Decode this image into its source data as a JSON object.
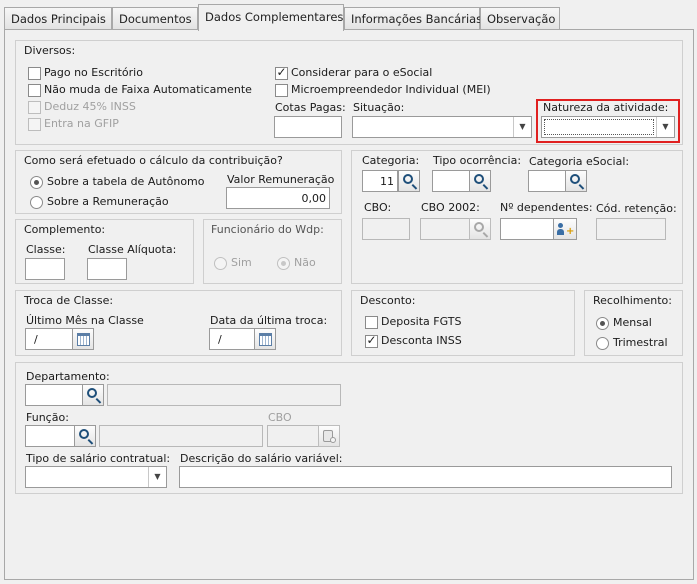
{
  "tabs": [
    "Dados Principais",
    "Documentos",
    "Dados Complementares",
    "Informações Bancárias",
    "Observação"
  ],
  "diversos": {
    "title": "Diversos:",
    "pago_escritorio": "Pago no Escritório",
    "nao_muda_faixa": "Não muda de Faixa Automaticamente",
    "deduz_inss": "Deduz 45% INSS",
    "entra_gfip": "Entra na GFIP",
    "considerar_esocial": "Considerar para o eSocial",
    "mei": "Microempreendedor Individual (MEI)",
    "cotas_pagas": "Cotas Pagas:",
    "situacao": "Situação:",
    "natureza": "Natureza da atividade:"
  },
  "calculo": {
    "title": "Como será efetuado o cálculo da contribuição?",
    "opt_autonomo": "Sobre a tabela de Autônomo",
    "opt_remuneracao": "Sobre a Remuneração",
    "valor_label": "Valor Remuneração",
    "valor": "0,00"
  },
  "categoria": {
    "categoria_label": "Categoria:",
    "categoria_value": "11",
    "tipo_ocorrencia": "Tipo ocorrência:",
    "categoria_esocial": "Categoria eSocial:",
    "cbo": "CBO:",
    "cbo2002": "CBO 2002:",
    "dependentes": "Nº dependentes:",
    "cod_retencao": "Cód. retenção:"
  },
  "complemento": {
    "title": "Complemento:",
    "classe": "Classe:",
    "classe_aliquota": "Classe Alíquota:"
  },
  "funcionario": {
    "title": "Funcionário do Wdp:",
    "sim": "Sim",
    "nao": "Não"
  },
  "troca": {
    "title": "Troca de Classe:",
    "ultimo_mes": "Último Mês na Classe",
    "ultimo_mes_value": "/",
    "data_ultima": "Data da última troca:",
    "data_ultima_value": "/"
  },
  "desconto": {
    "title": "Desconto:",
    "deposita_fgts": "Deposita FGTS",
    "desconta_inss": "Desconta INSS"
  },
  "recolhimento": {
    "title": "Recolhimento:",
    "mensal": "Mensal",
    "trimestral": "Trimestral"
  },
  "depto": {
    "departamento": "Departamento:",
    "funcao": "Função:",
    "cbo": "CBO",
    "tipo_salario": "Tipo de salário contratual:",
    "descricao_salario": "Descrição do salário variável:"
  },
  "colors": {
    "highlight": "#e02020",
    "border": "#a8a8a8",
    "panel": "#f0f0f0"
  }
}
